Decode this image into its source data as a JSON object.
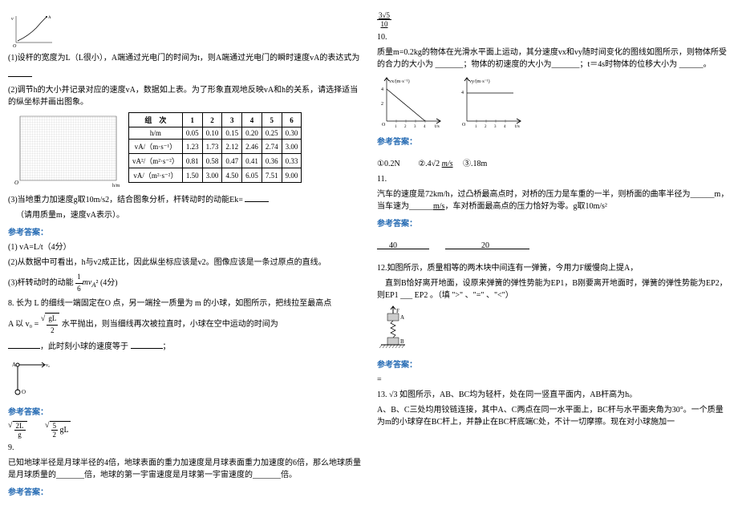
{
  "left": {
    "q1_text": "(1)设杆的宽度为L（L很小），A端通过光电门的时间为t，则A端通过光电门的瞬时速度vA的表达式为",
    "q1_blank": "______",
    "q2_text": "(2)调节h的大小并记录对应的速度vA，数据如上表。为了形象直观地反映vA和h的关系，请选择适当的纵坐标并画出图象。",
    "table": {
      "header": [
        "组　次",
        "1",
        "2",
        "3",
        "4",
        "5",
        "6"
      ],
      "rows": [
        [
          "h/m",
          "0.05",
          "0.10",
          "0.15",
          "0.20",
          "0.25",
          "0.30"
        ],
        [
          "vA/（m·s⁻¹）",
          "1.23",
          "1.73",
          "2.12",
          "2.46",
          "2.74",
          "3.00"
        ],
        [
          "vA²/（m²·s⁻²）",
          "0.81",
          "0.58",
          "0.47",
          "0.41",
          "0.36",
          "0.33"
        ],
        [
          "vA/（m²·s⁻²）",
          "1.50",
          "3.00",
          "4.50",
          "6.05",
          "7.51",
          "9.00"
        ]
      ]
    },
    "q3_text": "(3)当地重力加速度g取10m/s2，结合图象分析，杆转动时的动能Ek=",
    "q3_note": "（请用质量m，速度vA表示）。",
    "ans_label1": "参考答案：",
    "a1": "(1) vA=L/t（4分）",
    "a2": "(2)从数据中可看出，h与v2成正比，因此纵坐标应该是v2。图像应该是一条过原点的直线。",
    "a3_prefix": "(3)杆转动时的动能",
    "a3_postfix": "(4分)",
    "q8_text": "8. 长为 L 的细线一端固定在O 点，另一端拴一质量为 m 的小球，如图所示，把线拉至最高点",
    "q8_text2": "水平抛出，则当细线再次被拉直时，小球在空中运动的时间为",
    "q8_text3": "，此时刻小球的速度等于",
    "q8_text4": "；",
    "q8_v0": "A 以",
    "ans_label8": "参考答案：",
    "q9_num": "9.",
    "q9_text": "已知地球半径是月球半径的4倍，地球表面的重力加速度是月球表面重力加速度的6倍，那么地球质量是月球质量的_______倍，地球的第一宇宙速度是月球第一宇宙速度的_______倍。",
    "ans_label9": "参考答案："
  },
  "right": {
    "frac_top": "3√5",
    "frac_bot": "10",
    "q10_num": "10.",
    "q10_text": "质量m=0.2kg的物体在光滑水平面上运动，其分速度vx和vy随时间变化的图线如图所示，则物体所受的合力的大小为 _______；物体的初速度的大小为_______；t＝4s时物体的位移大小为 ______。",
    "ans_label10": "参考答案：",
    "a10_1": "①0.2N",
    "a10_2": "②.4√2",
    "a10_2_unit": "m/s",
    "a10_3": "③.18m",
    "q11_num": "11.",
    "q11_text": "汽车的速度是",
    "q11_speed": "72km/h",
    "q11_text2": "，过凸桥最高点时，对桥的压力是车重的一半，则桥面的曲率半径为______m，当车速为______",
    "q11_unit": "m/s",
    "q11_text3": "，车对桥面最高点的压力恰好为零。g取10",
    "q11_ms2": "m/s²",
    "ans_label11": "参考答案：",
    "a11_1": "___40________",
    "a11_2": "_________20__________",
    "q12_num": "12.",
    "q12_text": "如图所示，质量相等的两木块中间连有一弹簧，今用力F缓慢向上提A，",
    "q12_text2": "直到B恰好离开地面，设原来弹簧的弹性势能为EP1，B刚要离开地面时，弹簧的弹性势能为EP2，则EP1 ___ EP2 。（填 \">\" 、\"=\" 、\"<\"）",
    "ans_label12": "参考答案：",
    "a12": "=",
    "q13_num": "13.",
    "q13_lead": "√3",
    "q13_text": "如图所示，AB、BC均为轻杆，处在同一竖直平面内，AB杆高为h。",
    "q13_text2": "A、B、C三处均用铰链连接，其中A、C两点在同一水平面上，BC杆与水平面夹角为30°。一个质量为m的小球穿在BC杆上，并静止在BC杆底端C处，不计一切摩擦。现在对小球施加一"
  }
}
